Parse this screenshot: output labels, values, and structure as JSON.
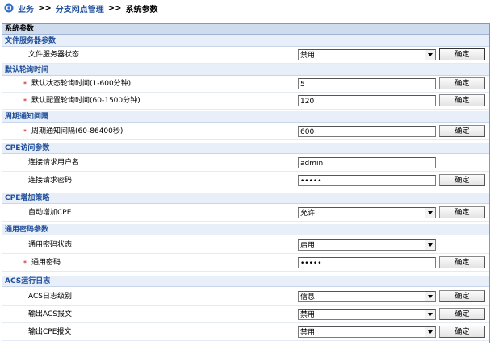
{
  "breadcrumb": {
    "item1": "业务",
    "sep1": ">>",
    "item2": "分支网点管理",
    "sep2": ">>",
    "current": "系统参数"
  },
  "panel_title": "系统参数",
  "confirm_label": "确定",
  "sections": {
    "file_server": {
      "title": "文件服务器参数",
      "status": {
        "label": "文件服务器状态",
        "value": "禁用"
      }
    },
    "polling": {
      "title": "默认轮询时间",
      "status_poll": {
        "label": "默认状态轮询时间(1-600分钟)",
        "value": "5"
      },
      "config_poll": {
        "label": "默认配置轮询时间(60-1500分钟)",
        "value": "120"
      }
    },
    "periodic": {
      "title": "周期通知间隔",
      "interval": {
        "label": "周期通知间隔(60-86400秒)",
        "value": "600"
      }
    },
    "cpe_access": {
      "title": "CPE访问参数",
      "username": {
        "label": "连接请求用户名",
        "value": "admin"
      },
      "password": {
        "label": "连接请求密码",
        "value": "•••••"
      }
    },
    "cpe_add": {
      "title": "CPE增加策略",
      "auto_add": {
        "label": "自动增加CPE",
        "value": "允许"
      }
    },
    "common_password": {
      "title": "通用密码参数",
      "status": {
        "label": "通用密码状态",
        "value": "启用"
      },
      "password": {
        "label": "通用密码",
        "value": "•••••"
      }
    },
    "acs_log": {
      "title": "ACS运行日志",
      "level": {
        "label": "ACS日志级别",
        "value": "信息"
      },
      "acs_msg": {
        "label": "输出ACS报文",
        "value": "禁用"
      },
      "cpe_msg": {
        "label": "输出CPE报文",
        "value": "禁用"
      }
    }
  },
  "required_marker": "*"
}
